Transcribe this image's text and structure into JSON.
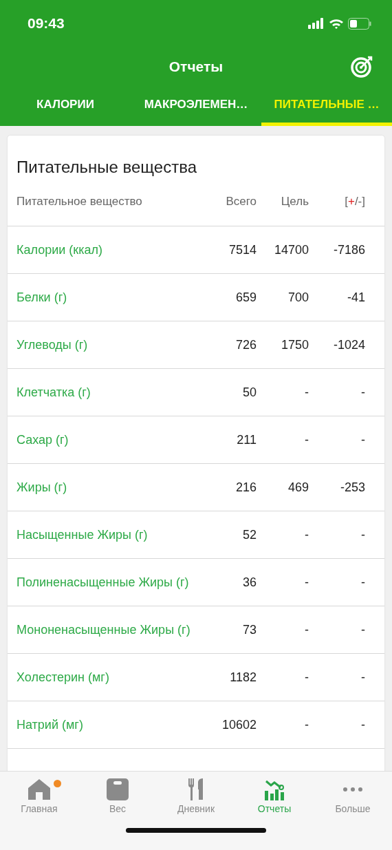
{
  "status_bar": {
    "time": "09:43"
  },
  "header": {
    "title": "Отчеты"
  },
  "tabs": [
    {
      "label": "КАЛОРИИ",
      "selected": false
    },
    {
      "label": "МАКРОЭЛЕМЕН…",
      "selected": false
    },
    {
      "label": "ПИТАТЕЛЬНЫЕ …",
      "selected": true
    }
  ],
  "card": {
    "title": "Питательные вещества",
    "columns": {
      "name": "Питательное вещество",
      "total": "Всего",
      "goal": "Цель",
      "diff": [
        "[",
        "+",
        "/-]"
      ]
    },
    "rows": [
      {
        "name": "Калории (ккал)",
        "total": "7514",
        "goal": "14700",
        "diff": "-7186"
      },
      {
        "name": "Белки (г)",
        "total": "659",
        "goal": "700",
        "diff": "-41"
      },
      {
        "name": "Углеводы (г)",
        "total": "726",
        "goal": "1750",
        "diff": "-1024"
      },
      {
        "name": "Клетчатка (г)",
        "total": "50",
        "goal": "-",
        "diff": "-"
      },
      {
        "name": "Сахар (г)",
        "total": "211",
        "goal": "-",
        "diff": "-"
      },
      {
        "name": "Жиры (г)",
        "total": "216",
        "goal": "469",
        "diff": "-253"
      },
      {
        "name": "Насыщенные Жиры (г)",
        "total": "52",
        "goal": "-",
        "diff": "-"
      },
      {
        "name": "Полиненасыщенные Жиры (г)",
        "total": "36",
        "goal": "-",
        "diff": "-"
      },
      {
        "name": "Мононенасыщенные Жиры (г)",
        "total": "73",
        "goal": "-",
        "diff": "-"
      },
      {
        "name": "Холестерин (мг)",
        "total": "1182",
        "goal": "-",
        "diff": "-"
      },
      {
        "name": "Натрий (мг)",
        "total": "10602",
        "goal": "-",
        "diff": "-"
      }
    ]
  },
  "bottom_nav": [
    {
      "kind": "home",
      "label": "Главная",
      "selected": false,
      "badge": true
    },
    {
      "kind": "weight",
      "label": "Вес",
      "selected": false,
      "badge": false
    },
    {
      "kind": "diary",
      "label": "Дневник",
      "selected": false,
      "badge": false
    },
    {
      "kind": "reports",
      "label": "Отчеты",
      "selected": true,
      "badge": false
    },
    {
      "kind": "more",
      "label": "Больше",
      "selected": false,
      "badge": false
    }
  ]
}
